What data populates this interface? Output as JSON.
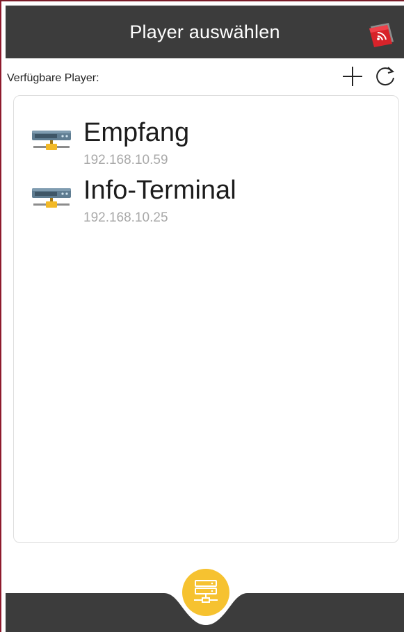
{
  "header": {
    "title": "Player auswählen"
  },
  "list_label": "Verfügbare Player:",
  "toolbar": {
    "add_icon": "plus-icon",
    "refresh_icon": "refresh-icon"
  },
  "players": [
    {
      "name": "Empfang",
      "ip": "192.168.10.59",
      "icon": "server-network-icon"
    },
    {
      "name": "Info-Terminal",
      "ip": "192.168.10.25",
      "icon": "server-network-icon"
    }
  ],
  "fab": {
    "icon": "server-list-icon"
  },
  "colors": {
    "header_bg": "#3c3c3c",
    "accent_yellow": "#f6c230",
    "logo_red": "#d8232a",
    "ip_text": "#a9a9a9"
  }
}
